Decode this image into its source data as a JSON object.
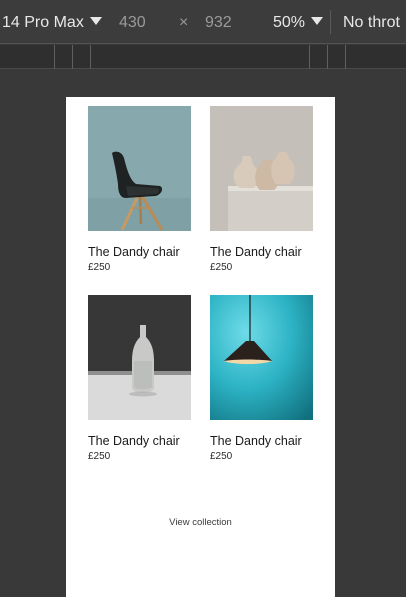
{
  "toolbar": {
    "device": "14 Pro Max",
    "width": "430",
    "times": "×",
    "height": "932",
    "zoom": "50%",
    "throttle": "No throt"
  },
  "products": [
    {
      "name": "The Dandy chair",
      "price": "£250",
      "image": "black-chair-image"
    },
    {
      "name": "The Dandy chair",
      "price": "£250",
      "image": "ceramic-vases-image"
    },
    {
      "name": "The Dandy chair",
      "price": "£250",
      "image": "white-bottle-vase-image"
    },
    {
      "name": "The Dandy chair",
      "price": "£250",
      "image": "pendant-lamp-image"
    }
  ],
  "view_collection": "View collection",
  "colors": {
    "chair_bg": "#87a9ad",
    "vases_bg": "#c4bfb7",
    "bottle_bg": "#3a3b3a",
    "lamp_bg": "#2cb3c4"
  }
}
